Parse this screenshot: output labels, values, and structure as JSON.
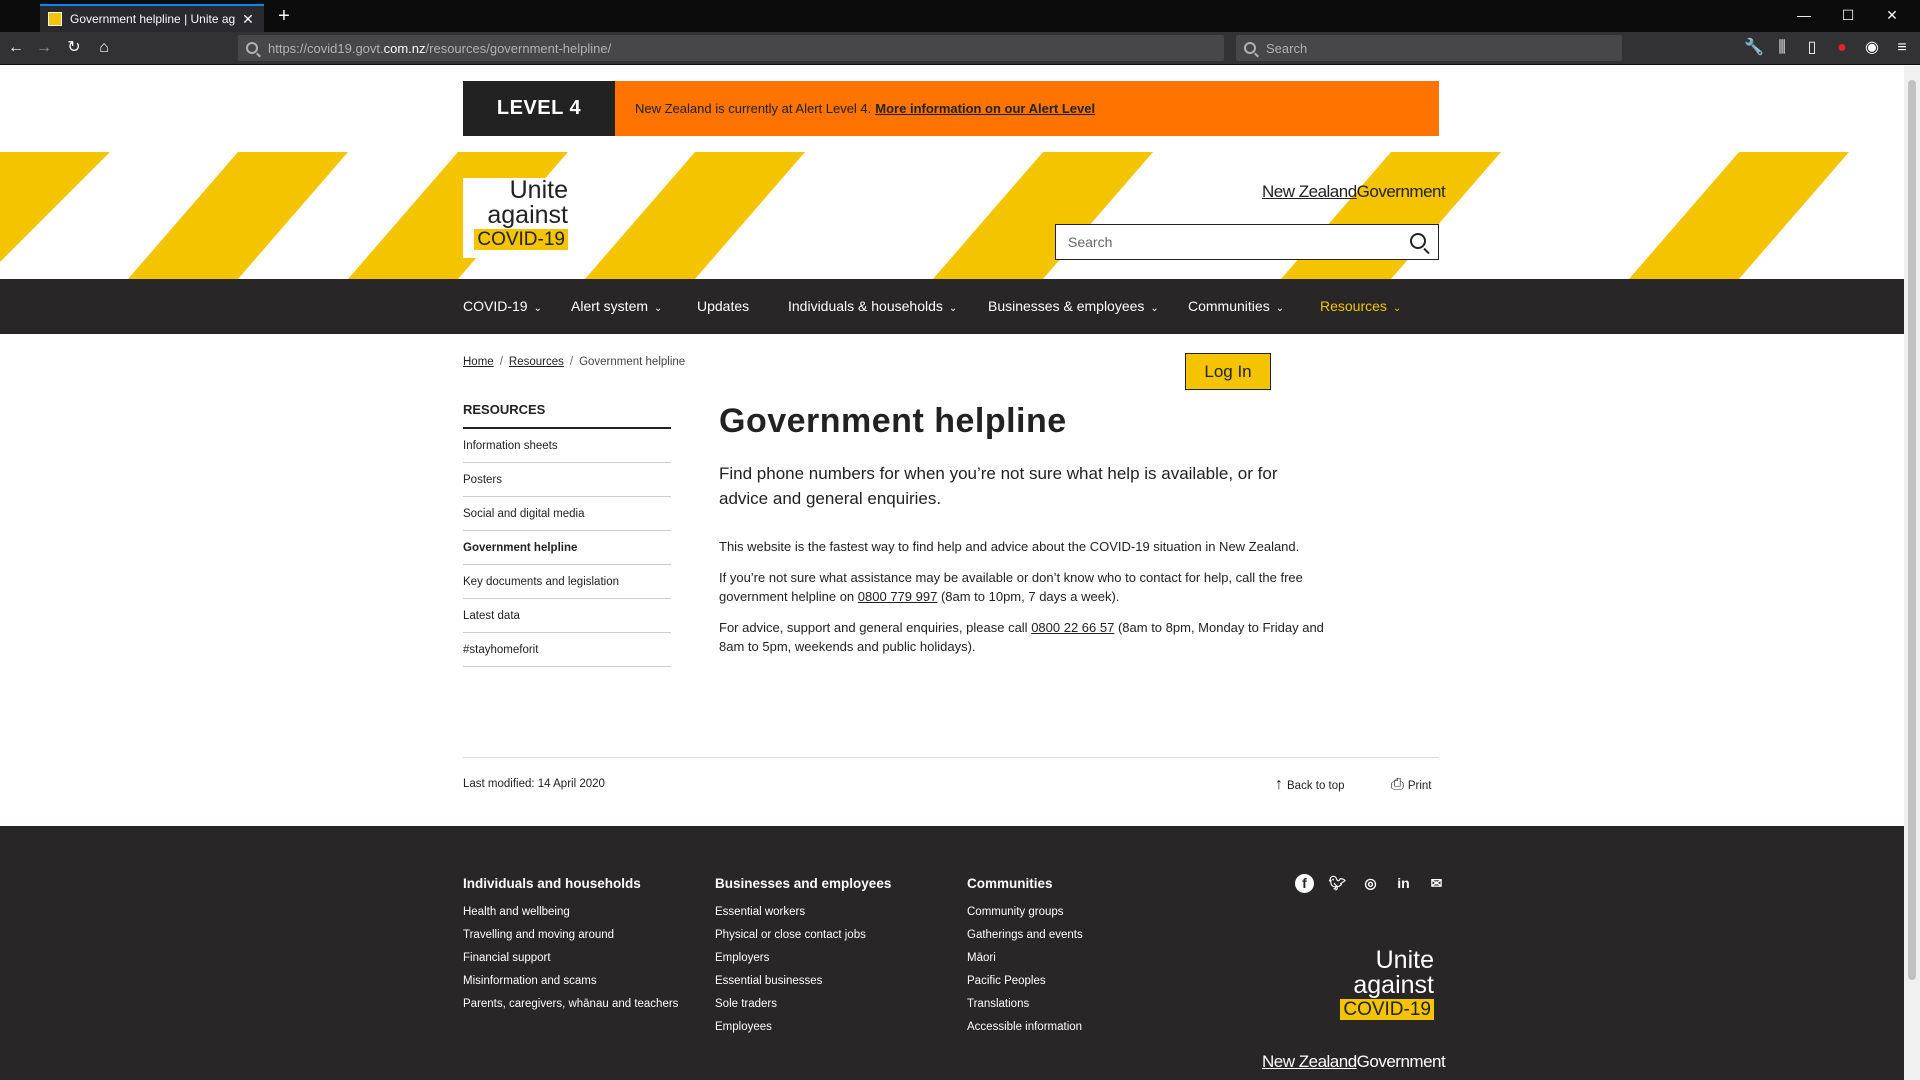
{
  "browser": {
    "tab_title": "Government helpline | Unite ag",
    "tab_close": "✕",
    "new_tab": "+",
    "url_prefix": "https://covid19.govt.",
    "url_domain": "com.nz",
    "url_suffix": "/resources/government-helpline/",
    "search_placeholder": "Search"
  },
  "alert": {
    "level": "LEVEL 4",
    "message": "New Zealand is currently at Alert Level 4.",
    "link": "More information on our Alert Level"
  },
  "logo": {
    "line1": "Unite",
    "line2": "against",
    "line3": "COVID-19"
  },
  "brand": {
    "nzg_left": "New Zealand",
    "nzg_right": "Government"
  },
  "site_search": {
    "placeholder": "Search"
  },
  "nav": {
    "items": [
      {
        "label": "COVID-19",
        "dropdown": true
      },
      {
        "label": "Alert system",
        "dropdown": true
      },
      {
        "label": "Updates",
        "dropdown": false
      },
      {
        "label": "Individuals & households",
        "dropdown": true
      },
      {
        "label": "Businesses & employees",
        "dropdown": true
      },
      {
        "label": "Communities",
        "dropdown": true
      },
      {
        "label": "Resources",
        "dropdown": true,
        "active": true
      }
    ],
    "chevron": "⌄"
  },
  "breadcrumb": {
    "home": "Home",
    "resources": "Resources",
    "current": "Government helpline",
    "sep": "/"
  },
  "login": "Log In",
  "sidebar": {
    "heading": "RESOURCES",
    "items": [
      "Information sheets",
      "Posters",
      "Social and digital media",
      "Government helpline",
      "Key documents and legislation",
      "Latest data",
      "#stayhomeforit"
    ]
  },
  "main": {
    "title": "Government helpline",
    "lede": "Find phone numbers for when you’re not sure what help is available, or for advice and general enquiries.",
    "p1": "This website is the fastest way to find help and advice about the COVID-19 situation in New Zealand.",
    "p2_a": "If you’re not sure what assistance may be available or don’t know who to contact for help, call the free government helpline on",
    "p2_phone": "0800 779 997",
    "p2_b": "(8am to 10pm, 7 days a week).",
    "p3_a": "For advice, support and general enquiries, please call",
    "p3_phone": "0800 22 66 57",
    "p3_b": "(8am to 8pm, Monday to Friday and 8am to 5pm, weekends and public holidays)."
  },
  "meta": {
    "modified": "Last modified: 14 April 2020",
    "back_to_top": "Back to top",
    "print": "Print"
  },
  "footer": {
    "columns": [
      {
        "heading": "Individuals and households",
        "links": [
          "Health and wellbeing",
          "Travelling and moving around",
          "Financial support",
          "Misinformation and scams",
          "Parents, caregivers, whānau and teachers"
        ]
      },
      {
        "heading": "Businesses and employees",
        "links": [
          "Essential workers",
          "Physical or close contact jobs",
          "Employers",
          "Essential businesses",
          "Sole traders",
          "Employees"
        ]
      },
      {
        "heading": "Communities",
        "links": [
          "Community groups",
          "Gatherings and events",
          "Māori",
          "Pacific Peoples",
          "Translations",
          "Accessible information"
        ]
      }
    ],
    "social": [
      "facebook-icon",
      "twitter-icon",
      "instagram-icon",
      "linkedin-icon",
      "email-icon"
    ]
  },
  "colors": {
    "brand_yellow": "#f5c400",
    "alert_orange": "#ff7300",
    "dark": "#282626"
  }
}
